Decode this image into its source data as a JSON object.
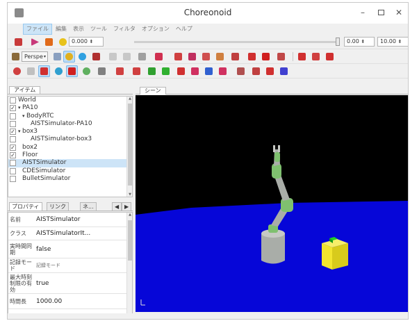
{
  "window": {
    "title": "Choreonoid"
  },
  "menu": [
    "ファイル",
    "編集",
    "表示",
    "ツール",
    "フィルタ",
    "オプション",
    "ヘルプ"
  ],
  "toolbar": {
    "time_current": "0.000",
    "time_start": "0.00",
    "time_end": "10.00",
    "perspective_label": "Perspe"
  },
  "items_panel": {
    "tab_label": "アイテム",
    "tree": [
      {
        "label": "World",
        "checked": false,
        "indent": 0
      },
      {
        "label": "PA10",
        "checked": true,
        "indent": 1
      },
      {
        "label": "BodyRTC",
        "checked": false,
        "indent": 2
      },
      {
        "label": "AISTSimulator-PA10",
        "checked": false,
        "indent": 3
      },
      {
        "label": "box3",
        "checked": true,
        "indent": 1
      },
      {
        "label": "AISTSimulator-box3",
        "checked": false,
        "indent": 3
      },
      {
        "label": "box2",
        "checked": true,
        "indent": 1
      },
      {
        "label": "Floor",
        "checked": true,
        "indent": 1
      },
      {
        "label": "AISTSimulator",
        "checked": false,
        "indent": 1
      },
      {
        "label": "CDESimulator",
        "checked": false,
        "indent": 1
      },
      {
        "label": "BulletSimulator",
        "checked": false,
        "indent": 1
      }
    ]
  },
  "property_panel": {
    "tabs": [
      "プロパティ",
      "リンク",
      "ネ..."
    ],
    "rows": [
      {
        "key": "名前",
        "value": "AISTSimulator"
      },
      {
        "key": "クラス",
        "value": "AISTSimulatorIt..."
      },
      {
        "key": "実時間同期",
        "value": "false"
      },
      {
        "key": "記録モード",
        "value": "記録モード"
      },
      {
        "key": "最大時刻制限の有効",
        "value": "true"
      },
      {
        "key": "時間長",
        "value": "1000.00"
      }
    ]
  },
  "scene_view": {
    "tab_label": "シーン"
  },
  "colors": {
    "scene_background": "#000000",
    "floor": "#0606d8",
    "robot_link": "#a9ada8",
    "robot_joint": "#7fc06f",
    "box": "#f2e52f",
    "box_marker": "#1fcf25"
  }
}
